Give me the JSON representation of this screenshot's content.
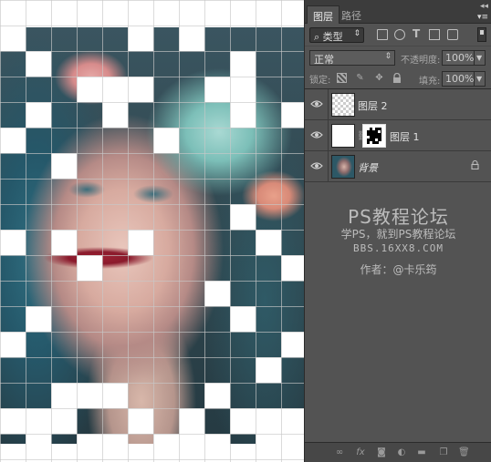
{
  "panel": {
    "tabs": [
      {
        "label": "图层",
        "active": true
      },
      {
        "label": "路径",
        "active": false
      }
    ],
    "collapse_glyph": "◂◂",
    "menu_glyph": "▾≡",
    "filter": {
      "label": "类型",
      "icon": "search-icon"
    },
    "blend_mode": "正常",
    "opacity_label": "不透明度:",
    "opacity_value": "100%",
    "lock_label": "锁定:",
    "fill_label": "填充:",
    "fill_value": "100%",
    "layers": [
      {
        "name": "图层 2",
        "visible": true,
        "thumbnail": "transparent-checker"
      },
      {
        "name": "图层 1",
        "visible": true,
        "thumbnail": "white-with-mask"
      },
      {
        "name": "背景",
        "visible": true,
        "thumbnail": "portrait",
        "locked": true
      }
    ]
  },
  "watermark": {
    "title": "PS教程论坛",
    "subtitle": "学PS，就到PS教程论坛",
    "url": "BBS.16XX8.COM",
    "author": "作者：@卡乐筠"
  },
  "colors": {
    "panel_bg": "#535353",
    "tabbar_bg": "#3c3c3c",
    "canvas_bg": "#ffffff"
  }
}
